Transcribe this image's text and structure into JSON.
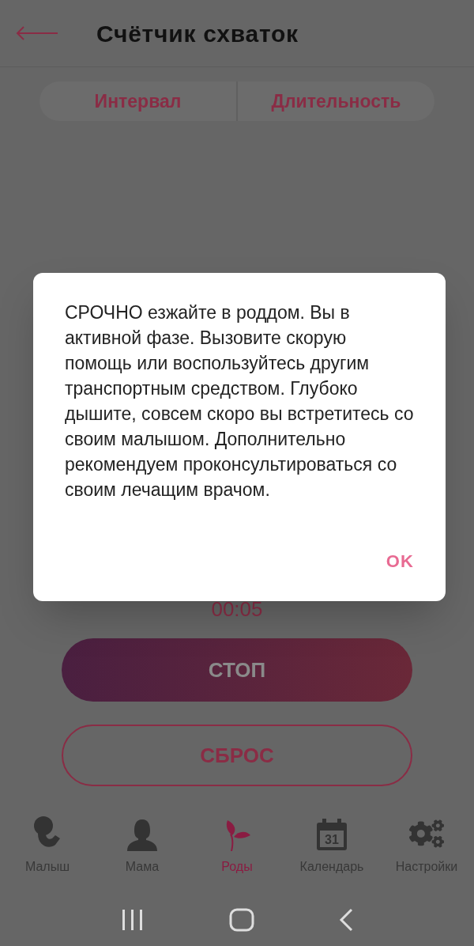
{
  "header": {
    "title": "Счётчик схваток"
  },
  "tabs": [
    {
      "label": "Интервал",
      "selected": false
    },
    {
      "label": "Длительность",
      "selected": false
    }
  ],
  "timer": "00:05",
  "buttons": {
    "stop": "СТОП",
    "reset": "СБРОС"
  },
  "dialog": {
    "message": "СРОЧНО езжайте в роддом. Вы в активной фазе. Вызовите скорую помощь или воспользуйтесь другим транспортным средством. Глубоко дышите, совсем скоро вы встретитесь со своим малышом. Дополнительно рекомендуем проконсультироваться со своим лечащим врачом.",
    "ok": "OK"
  },
  "bottom_nav": [
    {
      "kind": "baby",
      "label": "Малыш",
      "selected": false
    },
    {
      "kind": "mom",
      "label": "Мама",
      "selected": false
    },
    {
      "kind": "birth",
      "label": "Роды",
      "selected": true
    },
    {
      "kind": "calendar",
      "label": "Календарь",
      "selected": false,
      "icon_text": "31"
    },
    {
      "kind": "settings",
      "label": "Настройки",
      "selected": false
    }
  ]
}
